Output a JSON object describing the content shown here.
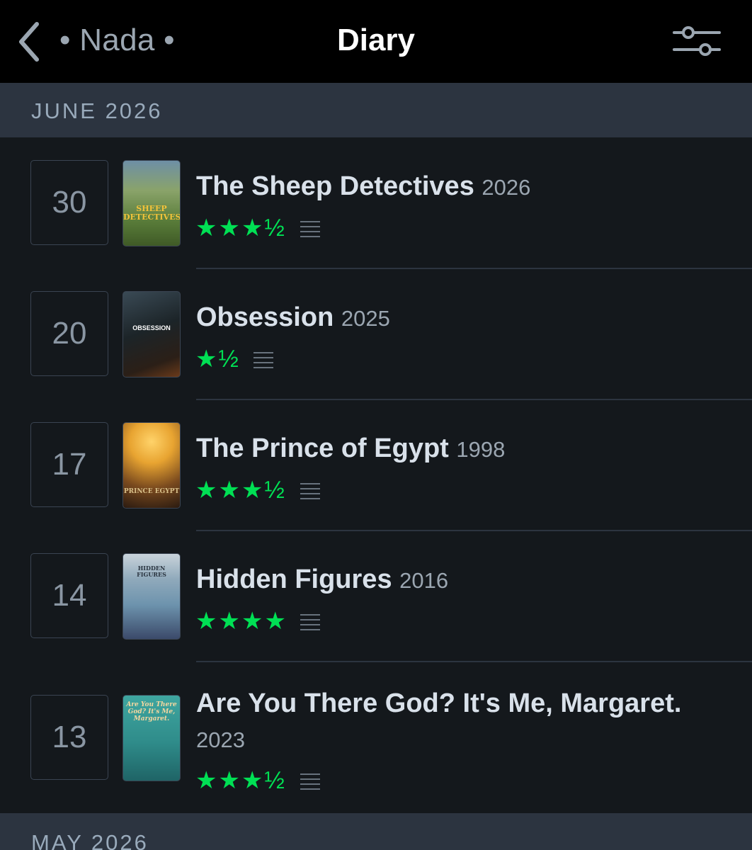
{
  "header": {
    "owner": "• Nada •",
    "title": "Diary"
  },
  "sections": [
    {
      "label": "JUNE 2026"
    },
    {
      "label": "MAY 2026"
    }
  ],
  "entries": [
    {
      "day": "30",
      "title": "The Sheep Detectives",
      "year": "2026",
      "rating": "★★★½",
      "poster_text": "SHEEP DETECTIVES",
      "colors": {
        "poster": "#5a7d3a"
      }
    },
    {
      "day": "20",
      "title": "Obsession",
      "year": "2025",
      "rating": "★½",
      "poster_text": "OBSESSION",
      "colors": {
        "poster": "#1c2428"
      }
    },
    {
      "day": "17",
      "title": "The Prince of Egypt",
      "year": "1998",
      "rating": "★★★½",
      "poster_text": "PRINCE EGYPT",
      "colors": {
        "poster": "#e8a431"
      }
    },
    {
      "day": "14",
      "title": "Hidden Figures",
      "year": "2016",
      "rating": "★★★★",
      "poster_text": "HIDDEN FIGURES",
      "colors": {
        "poster": "#6d93ad"
      }
    },
    {
      "day": "13",
      "title": "Are You There God? It's Me, Margaret.",
      "year": "2023",
      "rating": "★★★½",
      "poster_text": "Are You There God? It's Me, Margaret.",
      "colors": {
        "poster": "#2f8c8a"
      }
    }
  ],
  "colors": {
    "accent": "#00e054",
    "background": "#14181c",
    "section": "#2c3440"
  },
  "icons": {
    "back": "chevron-left-icon",
    "filter": "sliders-icon",
    "review": "review-lines-icon"
  }
}
